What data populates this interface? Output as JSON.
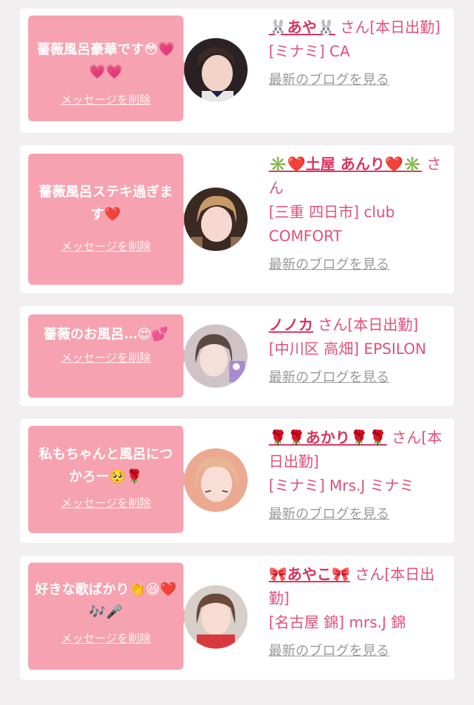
{
  "messages": [
    {
      "message": "薔薇風呂豪華です😳💗💗💗",
      "delete_label": "メッセージを削除",
      "name": "🐰あや🐰",
      "suffix": " さん[本日出勤]",
      "shop": "[ミナミ] CA",
      "blog_label": "最新のブログを見る"
    },
    {
      "message": "薔薇風呂ステキ過ぎます❤️",
      "delete_label": "メッセージを削除",
      "name": "✳️❤️土屋 あんり❤️✳️",
      "suffix": " さん",
      "shop": "[三重 四日市] club COMFORT",
      "blog_label": "最新のブログを見る"
    },
    {
      "message": "薔薇のお風呂…😍💕",
      "delete_label": "メッセージを削除",
      "name": "ノノカ",
      "suffix": " さん[本日出勤]",
      "shop": "[中川区 高畑] EPSILON",
      "blog_label": "最新のブログを見る"
    },
    {
      "message": "私もちゃんと風呂につかろー🥺🌹",
      "delete_label": "メッセージを削除",
      "name": "🌹🌹あかり🌹🌹",
      "suffix": " さん[本日出勤]",
      "shop": "[ミナミ] Mrs.J ミナミ",
      "blog_label": "最新のブログを見る"
    },
    {
      "message": "好きな歌ばかり👏😆❤️🎶🎤",
      "delete_label": "メッセージを削除",
      "name": "🎀あやこ🎀",
      "suffix": " さん[本日出勤]",
      "shop": "[名古屋 錦] mrs.J 錦",
      "blog_label": "最新のブログを見る"
    }
  ],
  "colors": {
    "bubble": "#f7a2b0",
    "accent": "#d8335f",
    "text": "#e0507a",
    "muted": "#9a9a9a",
    "background": "#f1eff0"
  }
}
